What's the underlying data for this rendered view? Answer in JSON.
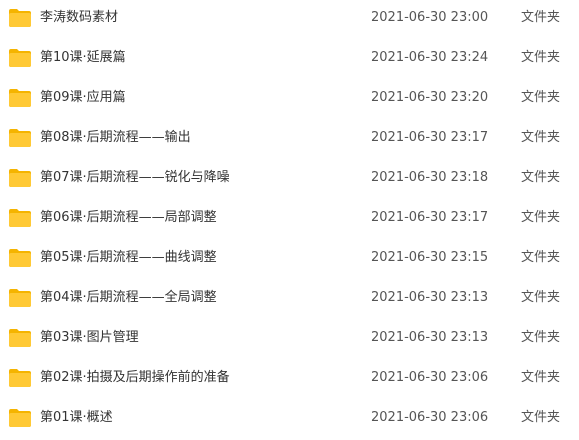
{
  "files": [
    {
      "name": "李涛数码素材",
      "modified": "2021-06-30 23:00",
      "type": "文件夹",
      "icon": "folder-icon"
    },
    {
      "name": "第10课·延展篇",
      "modified": "2021-06-30 23:24",
      "type": "文件夹",
      "icon": "folder-icon"
    },
    {
      "name": "第09课·应用篇",
      "modified": "2021-06-30 23:20",
      "type": "文件夹",
      "icon": "folder-icon"
    },
    {
      "name": "第08课·后期流程——输出",
      "modified": "2021-06-30 23:17",
      "type": "文件夹",
      "icon": "folder-icon"
    },
    {
      "name": "第07课·后期流程——锐化与降噪",
      "modified": "2021-06-30 23:18",
      "type": "文件夹",
      "icon": "folder-icon"
    },
    {
      "name": "第06课·后期流程——局部调整",
      "modified": "2021-06-30 23:17",
      "type": "文件夹",
      "icon": "folder-icon"
    },
    {
      "name": "第05课·后期流程——曲线调整",
      "modified": "2021-06-30 23:15",
      "type": "文件夹",
      "icon": "folder-icon"
    },
    {
      "name": "第04课·后期流程——全局调整",
      "modified": "2021-06-30 23:13",
      "type": "文件夹",
      "icon": "folder-icon"
    },
    {
      "name": "第03课·图片管理",
      "modified": "2021-06-30 23:13",
      "type": "文件夹",
      "icon": "folder-icon"
    },
    {
      "name": "第02课·拍摄及后期操作前的准备",
      "modified": "2021-06-30 23:06",
      "type": "文件夹",
      "icon": "folder-icon"
    },
    {
      "name": "第01课·概述",
      "modified": "2021-06-30 23:06",
      "type": "文件夹",
      "icon": "folder-icon"
    }
  ],
  "colors": {
    "folder_body": "#FFC935",
    "folder_tab": "#F5B400",
    "text": "#333333",
    "muted_text": "#555555"
  }
}
